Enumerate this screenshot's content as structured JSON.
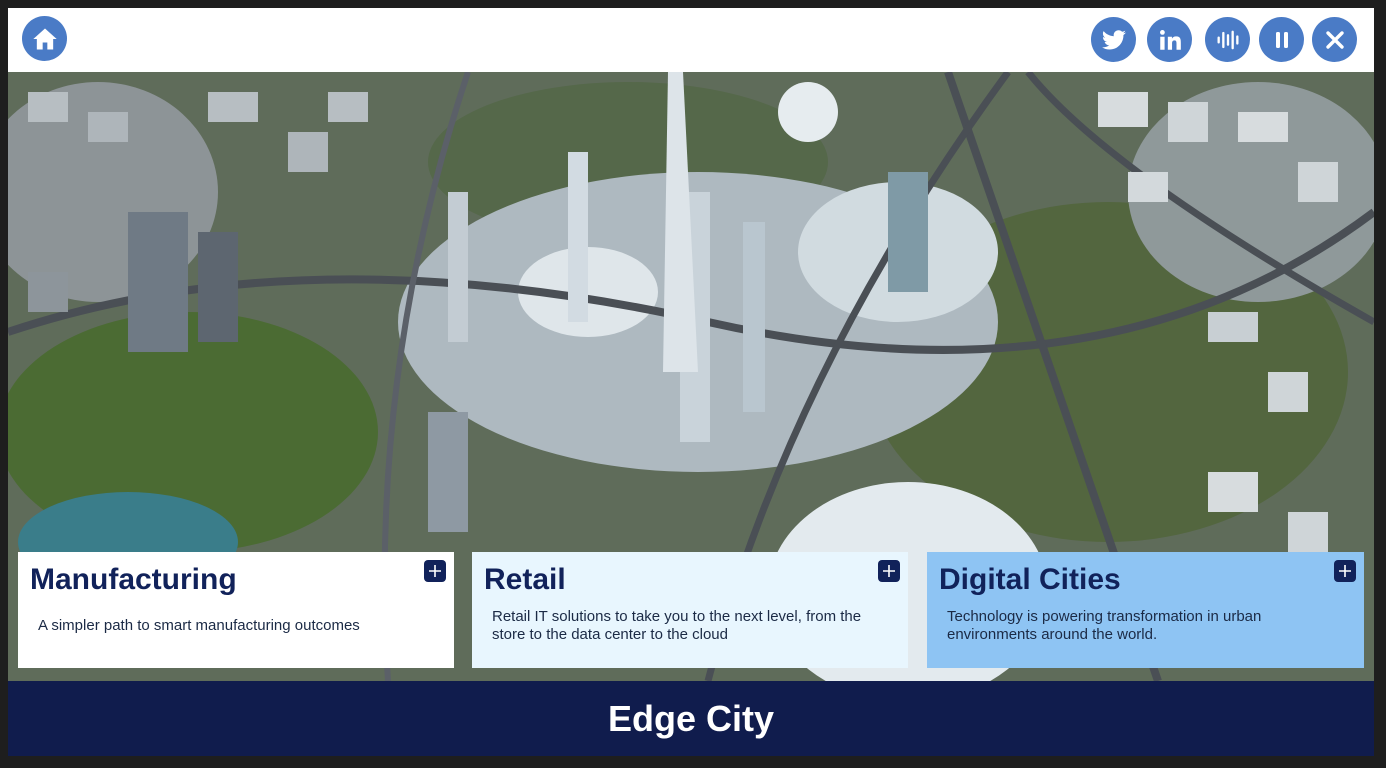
{
  "topbar": {
    "home_icon": "home-icon",
    "buttons": [
      {
        "name": "twitter-icon"
      },
      {
        "name": "linkedin-icon"
      },
      {
        "name": "audio-icon"
      },
      {
        "name": "pause-icon"
      },
      {
        "name": "close-icon"
      }
    ],
    "button_color": "#4a7bc6"
  },
  "cards": [
    {
      "title": "Manufacturing",
      "description": "A simpler path to smart manufacturing outcomes",
      "background": "#ffffff"
    },
    {
      "title": "Retail",
      "description": "Retail IT solutions to take you to the next level, from the store to the data center to the cloud",
      "background": "#e8f6fe"
    },
    {
      "title": "Digital Cities",
      "description": "Technology is powering transformation in urban environments around the world.",
      "background": "#8ec4f3"
    }
  ],
  "footer": {
    "title": "Edge City",
    "background": "#101c4d"
  }
}
